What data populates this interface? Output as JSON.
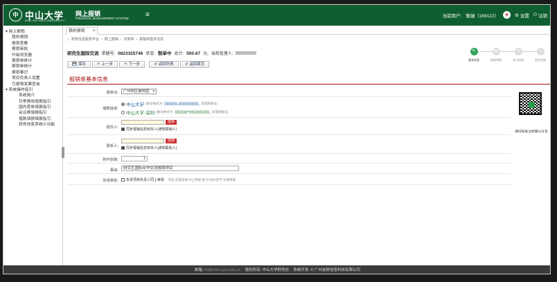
{
  "header": {
    "logo_seal": "中",
    "logo_cn": "中山大学",
    "logo_en": "SUN YAT-SEN UNIVERSITY",
    "system_cn": "网上报销",
    "system_en": "FINANCIAL MANAGEMENT SYSTEM",
    "menu_icon": "≡",
    "current_user_label": "当前用户:",
    "current_user": "敬瑞（169122）",
    "settings_label": "设置",
    "logout_label": "注销"
  },
  "sidebar": {
    "items": [
      {
        "label": "▾ 网上报销",
        "level": 0
      },
      {
        "label": "我的报销",
        "level": 1
      },
      {
        "label": "报销查看",
        "level": 1
      },
      {
        "label": "报销审批",
        "level": 1
      },
      {
        "label": "升级浏览器",
        "level": 1
      },
      {
        "label": "报销单统计",
        "level": 1
      },
      {
        "label": "报销单统计",
        "level": 1
      },
      {
        "label": "报销事识",
        "level": 1
      },
      {
        "label": "项目负责人设置",
        "level": 1
      },
      {
        "label": "已报销发票查询",
        "level": 1
      },
      {
        "label": "▾ 系统操作指引",
        "level": 0
      },
      {
        "label": "系统简介",
        "level": 2
      },
      {
        "label": "日常费用填报指引",
        "level": 2
      },
      {
        "label": "国内差旅填报指引",
        "level": 2
      },
      {
        "label": "会议费填报指引",
        "level": 2
      },
      {
        "label": "借款填报填报指引",
        "level": 2
      },
      {
        "label": "财务信息系统小功能",
        "level": 2
      }
    ]
  },
  "tabs": [
    {
      "label": "我的报销",
      "close": "×"
    }
  ],
  "breadcrumb": [
    "财务信息服务平台",
    "网上报销",
    "日常单",
    "报销单基本信息"
  ],
  "infobar": {
    "title": "研究生国际交流",
    "doc_no_label": "单据号:",
    "doc_no": "0823325746",
    "status_label": "状态:",
    "status": "制单中",
    "total_label": "总计:",
    "total": "500.67",
    "unit": "元;",
    "handler_label": "当前处理人:"
  },
  "toolbar": [
    {
      "label": "保存",
      "icon": "💾"
    },
    {
      "label": "上一步",
      "icon": "↶"
    },
    {
      "label": "下一步",
      "icon": "↷"
    },
    {
      "label": "返回列表",
      "icon": "↺"
    },
    {
      "label": "返回首页",
      "icon": "↺"
    }
  ],
  "steps": [
    {
      "label": "基本信息",
      "icon": "✎",
      "active": true
    },
    {
      "label": "报销明细",
      "icon": "▤",
      "active": false
    },
    {
      "label": "支付信息",
      "icon": "¥",
      "active": false
    },
    {
      "label": "提交完成",
      "icon": "✓",
      "active": false
    }
  ],
  "section_title": "报销单基本信息",
  "form": {
    "campus_label": "报单点:",
    "campus_value": "广州校区南校园",
    "credit_label": "借款信息:",
    "credit_option1_name": "中山大学",
    "credit_option1_hint": "(账号格式为:",
    "credit_option1_value": "00000-00000000,",
    "credit_option1_note": "非借款账号)",
    "credit_option2_name": "中山大学·深圳",
    "credit_option2_hint": "(账号格式为:",
    "credit_option2_value": "00000*00000000,",
    "credit_option2_note": "非借款账号)",
    "handler_label": "经办人:",
    "handler_btn": "选择",
    "handler_check": "同步报销信息到本人(通知报销人)",
    "contact_label": "联系人:",
    "contact_btn": "选择",
    "contact_check": "同步报销信息到本人(通知联系人)",
    "attachments_label": "附件张数:",
    "attachments_value": "1",
    "reason_label": "事由:",
    "reason_value": "研究生国际合作交流报销项目",
    "approval_label": "负责审批:",
    "approval_check": "负责项目负责人同上审批",
    "approval_note": "对还,还请选择\"同上审批\"即为\"经办签字\"方便审批;"
  },
  "qr_caption": "请扫码关注财服公众号",
  "footer": {
    "email_label": "邮箱:",
    "email_value": "fin@mail.sysu.edu.cn",
    "copyright_label": "版权所有:",
    "copyright_value": "中山大学财务处",
    "developer_label": "系统开发:",
    "developer_value": "© 广州友财信息科技有限公司"
  }
}
